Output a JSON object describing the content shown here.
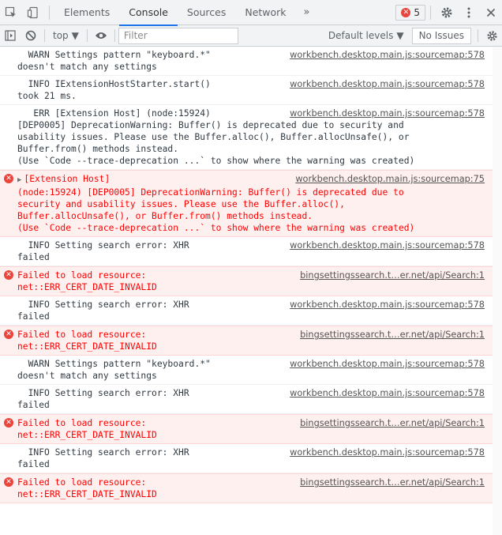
{
  "tabbar": {
    "tabs": [
      "Elements",
      "Console",
      "Sources",
      "Network"
    ],
    "more": "»",
    "error_count": "5"
  },
  "toolbar": {
    "context": "top",
    "filter_placeholder": "Filter",
    "levels": "Default levels",
    "issues": "No Issues"
  },
  "messages": [
    {
      "type": "info",
      "first": "  WARN Settings pattern \"keyboard.*\"",
      "rest": "doesn't match any settings",
      "src": "workbench.desktop.main.js:sourcemap:578"
    },
    {
      "type": "info",
      "first": "  INFO IExtensionHostStarter.start()",
      "rest": "took 21 ms.",
      "src": "workbench.desktop.main.js:sourcemap:578"
    },
    {
      "type": "info",
      "first": "   ERR [Extension Host] (node:15924)",
      "rest": "[DEP0005] DeprecationWarning: Buffer() is deprecated due to security and\nusability issues. Please use the Buffer.alloc(), Buffer.allocUnsafe(), or\nBuffer.from() methods instead.\n(Use `Code --trace-deprecation ...` to show where the warning was created)",
      "src": "workbench.desktop.main.js:sourcemap:578"
    },
    {
      "type": "error",
      "expand": true,
      "first": "[Extension Host]",
      "rest": "(node:15924) [DEP0005] DeprecationWarning: Buffer() is deprecated due to\nsecurity and usability issues. Please use the Buffer.alloc(),\nBuffer.allocUnsafe(), or Buffer.from() methods instead.\n(Use `Code --trace-deprecation ...` to show where the warning was created)",
      "src": "workbench.desktop.main.js:sourcemap:75"
    },
    {
      "type": "info",
      "first": "  INFO Setting search error: XHR",
      "rest": "failed",
      "src": "workbench.desktop.main.js:sourcemap:578"
    },
    {
      "type": "error",
      "first": "Failed to load resource:",
      "rest": "net::ERR_CERT_DATE_INVALID",
      "src": "bingsettingssearch.t…er.net/api/Search:1"
    },
    {
      "type": "info",
      "first": "  INFO Setting search error: XHR",
      "rest": "failed",
      "src": "workbench.desktop.main.js:sourcemap:578"
    },
    {
      "type": "error",
      "first": "Failed to load resource:",
      "rest": "net::ERR_CERT_DATE_INVALID",
      "src": "bingsettingssearch.t…er.net/api/Search:1"
    },
    {
      "type": "info",
      "first": "  WARN Settings pattern \"keyboard.*\"",
      "rest": "doesn't match any settings",
      "src": "workbench.desktop.main.js:sourcemap:578"
    },
    {
      "type": "info",
      "first": "  INFO Setting search error: XHR",
      "rest": "failed",
      "src": "workbench.desktop.main.js:sourcemap:578"
    },
    {
      "type": "error",
      "first": "Failed to load resource:",
      "rest": "net::ERR_CERT_DATE_INVALID",
      "src": "bingsettingssearch.t…er.net/api/Search:1"
    },
    {
      "type": "info",
      "first": "  INFO Setting search error: XHR",
      "rest": "failed",
      "src": "workbench.desktop.main.js:sourcemap:578"
    },
    {
      "type": "error",
      "first": "Failed to load resource:",
      "rest": "net::ERR_CERT_DATE_INVALID",
      "src": "bingsettingssearch.t…er.net/api/Search:1"
    }
  ]
}
